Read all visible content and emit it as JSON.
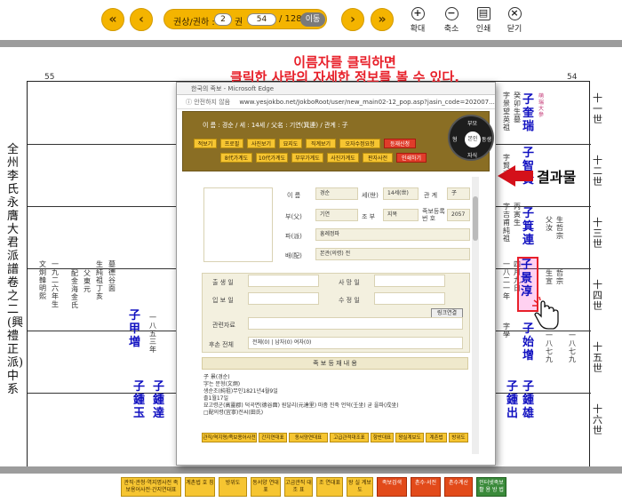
{
  "toolbar": {
    "first_icon": "«",
    "prev_icon": "‹",
    "volume_label": "권상/권하 :",
    "volume_value": "2",
    "page_unit": "권",
    "page_input": "54",
    "page_total": "/ 1283",
    "go_label": "이동",
    "next_icon": "›",
    "last_icon": "»",
    "zoom_in_label": "확대",
    "zoom_out_label": "축소",
    "print_label": "인쇄",
    "close_label": "닫기"
  },
  "page": {
    "left_page_number": "55",
    "right_page_number": "54",
    "book_title": "全州李氏永膺大君派譜 卷之二 (興禮正派) 中系",
    "generations": [
      "十一世",
      "十二世",
      "十三世",
      "十四世",
      "十五世",
      "十六世"
    ],
    "names": [
      {
        "text": "子 甲 増"
      },
      {
        "text": "子 鍾 玉"
      },
      {
        "text": "子 鍾 達"
      },
      {
        "text": "子 奎 瑞"
      },
      {
        "text": "子 智 賢"
      },
      {
        "text": "子 箕 連"
      },
      {
        "text": "子 始 增"
      },
      {
        "text": "子 鍾 出"
      },
      {
        "text": "子 鍾 雄"
      }
    ],
    "highlighted_name": "子 景 淳"
  },
  "annotation": {
    "line1": "이름자를 클릭하면",
    "line2": "클릭한 사람의 자세한 정보를 볼 수 있다.",
    "result_label": "결과물"
  },
  "popup": {
    "title": "한국의 족보 - Microsoft Edge",
    "security": "ⓘ 안전하지 않음",
    "url": "www.yesjokbo.net/JokboRoot/user/new_main02-12_pop.asp?jasin_code=202007...",
    "header_info": "이 름 : 경순  /  세 : 14세  /  父名 : 기연(箕連)  /  관계 : 子",
    "buttons_row1": [
      "적보기",
      "프로필",
      "사진보기",
      "묘지도",
      "직계보기",
      "오자수정요청",
      "등재신청"
    ],
    "buttons_row2": [
      "8代가계도",
      "10代가계도",
      "부부가계도",
      "사진가계도",
      "판자사전",
      "인쇄하기"
    ],
    "wheel": {
      "top": "부모",
      "left": "형",
      "right": "동생",
      "bottom": "자식",
      "center": "본인"
    },
    "fields": {
      "name_label": "이  름",
      "name_value": "경순",
      "gen_label": "세(世)",
      "gen_value": "14세(世)",
      "rel_label": "관  계",
      "rel_value": "子",
      "father_label": "부(父)",
      "father_value": "기연",
      "grandfather_label": "조  부",
      "grandfather_value": "지복",
      "jokbo_label": "족보등록 번  호",
      "jokbo_value": "2057",
      "clan_label": "파(派)",
      "clan_value": "흥례정파",
      "bae_label": "배(配)",
      "bae_value": "본관(의령) 전",
      "birth_label": "출 생 일",
      "death_label": "사 망 일",
      "adopt_label": "입 보 일",
      "fix_label": "수 정 일",
      "related_label": "관련자료",
      "link_button": "링크연결",
      "heir_label": "후손 전체",
      "heir_value": "전체(0)  |  남자(0)  여자(0)"
    },
    "section_title": "족 보 등 재 내 용",
    "notes": [
      "子 景(경순)",
      "字는 문형(文炯)",
      "생순조(純祖)무인1821년4월9일",
      "졸1월17일",
      "묘고령군(高靈郡) 덕곡면(德谷面) 원달리(元達里) 마좀 진죽 언덕(壬坐) 굳 을파(戌坐)",
      "□配의령(宜寧)전씨(田氏)"
    ],
    "bottom_buttons": [
      "관직/역지명/족보용어사전",
      "간지연대표",
      "동서양연대표",
      "고급관적대조표",
      "항반대표",
      "왕실계보도",
      "계촌법",
      "방위도"
    ]
  },
  "bottom_bar": [
    {
      "label": "관직·관청·역지명사전 족보용어사전·간지연대표",
      "style": "yellow"
    },
    {
      "label": "계촌법 호 칭",
      "style": "yellow"
    },
    {
      "label": "방위도",
      "style": "yellow"
    },
    {
      "label": "동서양 연대표",
      "style": "yellow"
    },
    {
      "label": "고금관직 대 조 표",
      "style": "yellow"
    },
    {
      "label": "조 연대표",
      "style": "yellow"
    },
    {
      "label": "왕 실 계보도",
      "style": "yellow"
    },
    {
      "label": "족보검색",
      "style": "red"
    },
    {
      "label": "촌수·서전",
      "style": "red"
    },
    {
      "label": "촌수계산",
      "style": "red"
    },
    {
      "label": "인터넷족보 활 용 방 법",
      "style": "green"
    }
  ]
}
